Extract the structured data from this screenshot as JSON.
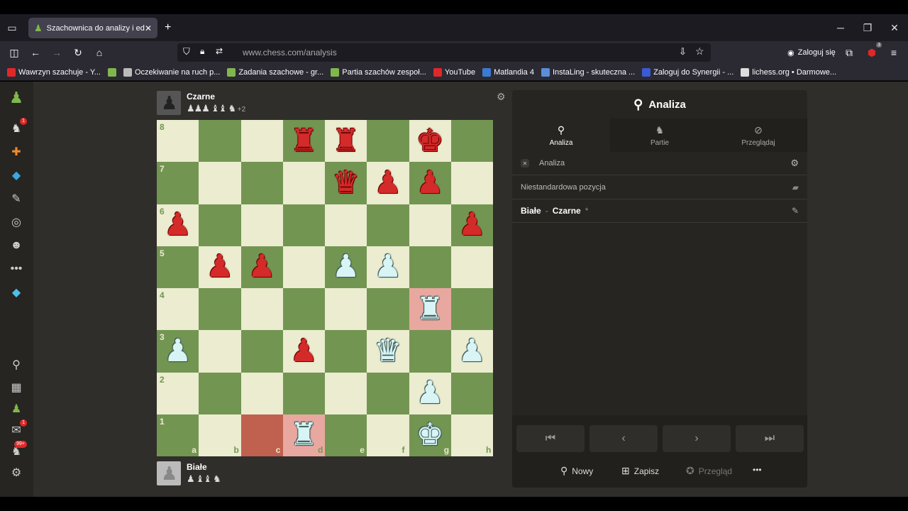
{
  "browser": {
    "tab_title": "Szachownica do analizy i edytor",
    "url_domain": "www.chess.com",
    "url_path": "/analysis",
    "login_label": "Zaloguj się",
    "ext_badge": "3",
    "bookmarks": [
      {
        "label": "Wawrzyn szachuje - Y...",
        "color": "#e02828"
      },
      {
        "label": "",
        "color": "#81b64c"
      },
      {
        "label": "Oczekiwanie na ruch p...",
        "color": "#bbbbbb"
      },
      {
        "label": "Zadania szachowe - gr...",
        "color": "#81b64c"
      },
      {
        "label": "Partia szachów zespoł...",
        "color": "#81b64c"
      },
      {
        "label": "YouTube",
        "color": "#e02828"
      },
      {
        "label": "Matlandia 4",
        "color": "#3a7bd5"
      },
      {
        "label": "InstaLing - skuteczna ...",
        "color": "#5b8dd9"
      },
      {
        "label": "Zaloguj do Synergii - ...",
        "color": "#3a5bd5"
      },
      {
        "label": "lichess.org • Darmowe...",
        "color": "#dddddd"
      }
    ]
  },
  "sidebar": {
    "badges": {
      "puzzles": "1",
      "messages": "1",
      "notifications": "99+"
    }
  },
  "top_player": {
    "name": "Czarne",
    "captured": "♟♟♟ ♝♝ ♞",
    "advantage": "+2"
  },
  "bottom_player": {
    "name": "Białe",
    "captured": "♟ ♝♝ ♞"
  },
  "board": {
    "files": [
      "a",
      "b",
      "c",
      "d",
      "e",
      "f",
      "g",
      "h"
    ],
    "ranks": [
      "8",
      "7",
      "6",
      "5",
      "4",
      "3",
      "2",
      "1"
    ],
    "colors": {
      "light": "#ebecd0",
      "dark": "#739552",
      "highlight": "#c0604f"
    },
    "highlighted": [
      "c1",
      "d1",
      "g4"
    ],
    "pieces": [
      {
        "sq": "d8",
        "type": "rook",
        "color": "black"
      },
      {
        "sq": "e8",
        "type": "rook",
        "color": "black"
      },
      {
        "sq": "g8",
        "type": "king",
        "color": "black"
      },
      {
        "sq": "e7",
        "type": "queen",
        "color": "black"
      },
      {
        "sq": "f7",
        "type": "pawn",
        "color": "black"
      },
      {
        "sq": "g7",
        "type": "pawn",
        "color": "black"
      },
      {
        "sq": "a6",
        "type": "pawn",
        "color": "black"
      },
      {
        "sq": "h6",
        "type": "pawn",
        "color": "black"
      },
      {
        "sq": "b5",
        "type": "pawn",
        "color": "black"
      },
      {
        "sq": "c5",
        "type": "pawn",
        "color": "black"
      },
      {
        "sq": "e5",
        "type": "pawn",
        "color": "white"
      },
      {
        "sq": "f5",
        "type": "pawn",
        "color": "white"
      },
      {
        "sq": "g4",
        "type": "rook",
        "color": "white"
      },
      {
        "sq": "a3",
        "type": "pawn",
        "color": "white"
      },
      {
        "sq": "d3",
        "type": "pawn",
        "color": "black"
      },
      {
        "sq": "f3",
        "type": "queen",
        "color": "white"
      },
      {
        "sq": "h3",
        "type": "pawn",
        "color": "white"
      },
      {
        "sq": "g2",
        "type": "pawn",
        "color": "white"
      },
      {
        "sq": "d1",
        "type": "rook",
        "color": "white"
      },
      {
        "sq": "g1",
        "type": "king",
        "color": "white"
      }
    ]
  },
  "panel": {
    "title": "Analiza",
    "tabs": [
      "Analiza",
      "Partie",
      "Przeglądaj"
    ],
    "active_tab": "Analiza",
    "analysis_toggle_label": "Analiza",
    "position_label": "Niestandardowa pozycja",
    "players_white": "Białe",
    "players_sep": "-",
    "players_black": "Czarne",
    "players_mark": "*",
    "actions": {
      "new": "Nowy",
      "save": "Zapisz",
      "review": "Przegląd"
    }
  }
}
